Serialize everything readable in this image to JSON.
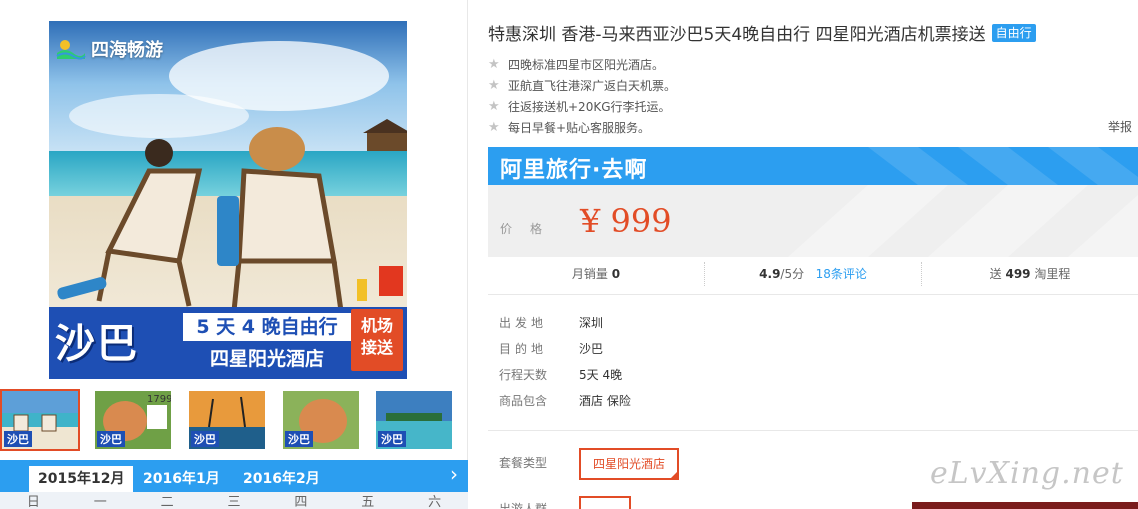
{
  "product": {
    "title": "特惠深圳 香港-马来西亚沙巴5天4晚自由行 四星阳光酒店机票接送",
    "tag": "自由行",
    "features": [
      "四晚标准四星市区阳光酒店。",
      "亚航直飞往港深广返白天机票。",
      "往返接送机+20KG行李托运。",
      "每日早餐+贴心客服服务。"
    ],
    "report_label": "举报"
  },
  "image": {
    "brand_logo_text": "四海畅游",
    "promo_destination": "沙巴",
    "promo_line1": "5 天 4 晚自由行",
    "promo_line2": "四星阳光酒店",
    "promo_badge_line1": "机场",
    "promo_badge_line2": "接送"
  },
  "thumbnails": [
    {
      "label": "沙巴",
      "active": true
    },
    {
      "label": "沙巴",
      "active": false
    },
    {
      "label": "沙巴",
      "active": false
    },
    {
      "label": "沙巴",
      "active": false
    },
    {
      "label": "沙巴",
      "active": false
    }
  ],
  "thumb_extra_text": "1799",
  "calendar": {
    "months": [
      "2015年12月",
      "2016年1月",
      "2016年2月"
    ],
    "active_month": "2015年12月",
    "next_icon": "chevron-right-icon",
    "weekdays": [
      "日",
      "一",
      "二",
      "三",
      "四",
      "五",
      "六"
    ]
  },
  "shop": {
    "name": "阿里旅行·去啊"
  },
  "price": {
    "label": "价格",
    "value": "¥ 999"
  },
  "stats": {
    "monthly_sales_label": "月销量",
    "monthly_sales_value": "0",
    "rating_value": "4.9",
    "rating_suffix": "/5分",
    "reviews_link": "18条评论",
    "points_prefix": "送",
    "points_value": "499",
    "points_suffix": "淘里程"
  },
  "details": [
    {
      "label": "出发地",
      "value": "深圳"
    },
    {
      "label": "目的地",
      "value": "沙巴"
    },
    {
      "label": "行程天数",
      "value": "5天 4晚"
    },
    {
      "label": "商品包含",
      "value": "酒店  保险"
    }
  ],
  "package": {
    "label": "套餐类型",
    "selected": "四星阳光酒店",
    "next_label": "出游人群"
  },
  "watermark": "eLvXing.net",
  "colors": {
    "accent_blue": "#2c9ef0",
    "price_red": "#e24c26",
    "banner_blue": "#1e4fb4"
  }
}
